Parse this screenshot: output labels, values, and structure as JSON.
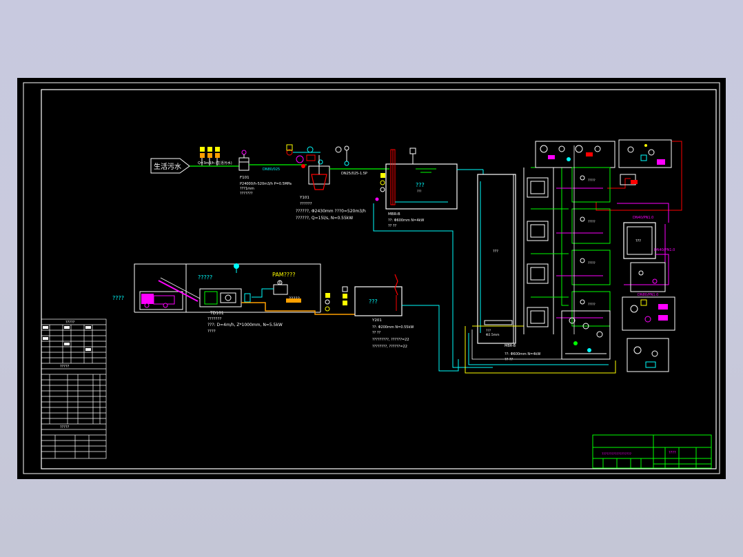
{
  "source_label": "生活污水",
  "flow_rate_label": "Q=3m3/h (生活污水)",
  "screen_tag": "F101",
  "screen_spec": "P24000/h-520m3/h  P=0.5MPa",
  "screen_note": "???1mm",
  "screen_note2": "???????",
  "pipe_label_1": "DN80/025",
  "pipe_label_2": "DN25/025-1.5P",
  "tank_tag": "Y101",
  "tank_spec_1": "??????",
  "tank_spec_2": "??????, Φ2430mm  ???0=520m3/h",
  "tank_spec_3": "??????, Q=15l/s, N=0.55kW",
  "bio_tank_label": "???",
  "bio_tank_spec_1": "MBR-B",
  "bio_tank_spec_2": "??: Φ600mm  N=4kW",
  "bio_tank_spec_3": "??  ??",
  "sludge_room_label": "?????",
  "pam_label": "PAM????",
  "sludge_pump_label": "?????",
  "truck_label": "????",
  "dewater_tag": "TD101",
  "dewater_spec_1": "???????",
  "dewater_spec_2": "???: D=4m/h,  Z*1000mm,  N=5.5kW",
  "dewater_spec_3": "????",
  "sludge_tank_label": "???",
  "sludge_tank_tag": "Y201",
  "sludge_tank_spec_1": "??: Φ200mm  N=0.55kW",
  "sludge_tank_spec_2": "??  ??",
  "sludge_tank_spec_3": "?????????, ??????=22",
  "sludge_tank_spec_4": "????????, ??????=22",
  "membrane_label": "???",
  "membrane_tag": "MBR-B",
  "membrane_spec": "??: Φ600mm  N=4kW",
  "right_tank_label": "???",
  "pink_label_1": "DN40/PN1.0",
  "pink_label_2": "DN40/PN1.0",
  "pink_label_3": "DN80/PN1.0",
  "legend_title": "?????",
  "legend_section_2": "?????",
  "legend_section_3": "?????",
  "title_block_caption": "??????????????????",
  "title_block_name": "????",
  "colors": {
    "canvas": "#000000",
    "frame": "#ffffff",
    "process_pipe": "#00ffff",
    "sludge_pipe": "#ffa000",
    "chemical_pipe": "#ff00ff",
    "air_pipe": "#00ff00",
    "return_pipe": "#ffff00",
    "signal": "#ff0000",
    "title_block": "#00ff00"
  }
}
